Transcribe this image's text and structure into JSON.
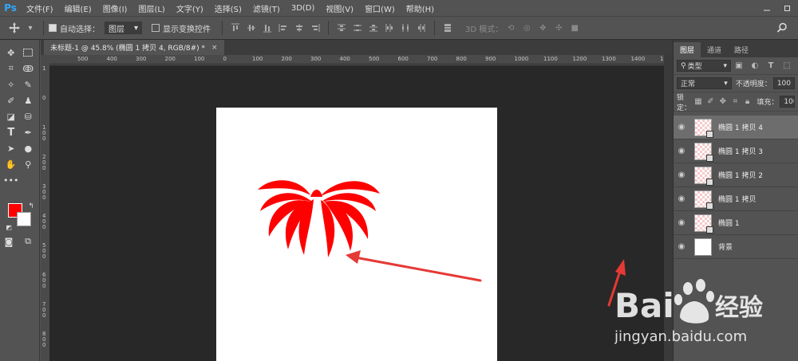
{
  "app": {
    "logo": "Ps"
  },
  "menu": [
    "文件(F)",
    "编辑(E)",
    "图像(I)",
    "图层(L)",
    "文字(Y)",
    "选择(S)",
    "滤镜(T)",
    "3D(D)",
    "视图(V)",
    "窗口(W)",
    "帮助(H)"
  ],
  "options": {
    "auto_select_label": "自动选择：",
    "auto_select_value": "图层",
    "show_transform_label": "显示变换控件",
    "mode_3d_label": "3D 模式："
  },
  "document": {
    "tab_title": "未标题-1 @ 45.8% (椭圆 1 拷贝 4, RGB/8#) *",
    "close_glyph": "×",
    "h_ticks": [
      "500",
      "400",
      "300",
      "200",
      "100",
      "0",
      "100",
      "200",
      "300",
      "400",
      "500",
      "600",
      "700",
      "800",
      "900",
      "1000",
      "1100",
      "1200",
      "1300",
      "1400",
      "1500"
    ],
    "v_ticks": [
      "1",
      "0",
      "1 0 0",
      "2 0 0",
      "3 0 0",
      "4 0 0",
      "5 0 0",
      "6 0 0",
      "7 0 0",
      "8 0 0"
    ]
  },
  "layers_panel": {
    "tabs": [
      "图层",
      "通道",
      "路径"
    ],
    "filter_label": "类型",
    "blend_mode": "正常",
    "opacity_label": "不透明度：",
    "opacity_value": "100",
    "lock_label": "锁定：",
    "fill_label": "填充：",
    "fill_value": "100",
    "layers": [
      {
        "name": "椭圆 1 拷贝 4",
        "selected": true
      },
      {
        "name": "椭圆 1 拷贝 3",
        "selected": false
      },
      {
        "name": "椭圆 1 拷贝 2",
        "selected": false
      },
      {
        "name": "椭圆 1 拷贝",
        "selected": false
      },
      {
        "name": "椭圆 1",
        "selected": false
      },
      {
        "name": "背景",
        "selected": false
      }
    ]
  },
  "colors": {
    "foreground": "#ff0000",
    "background": "#ffffff",
    "accent": "#31a8ff",
    "annotation": "#e53935"
  },
  "watermark": {
    "brand": "Bai",
    "brand2": "经验",
    "url": "jingyan.baidu.com"
  }
}
